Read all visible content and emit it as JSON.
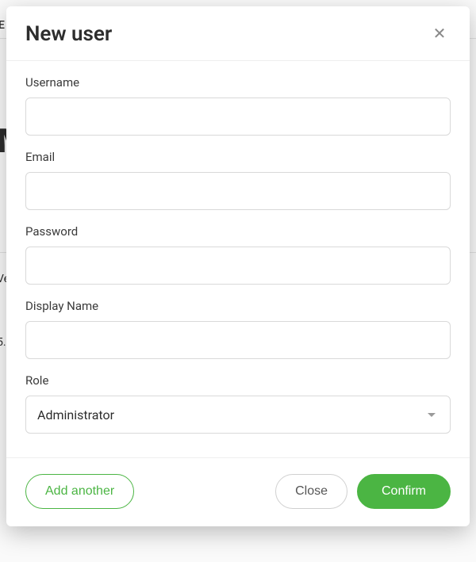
{
  "modal": {
    "title": "New user",
    "fields": {
      "username": {
        "label": "Username",
        "value": ""
      },
      "email": {
        "label": "Email",
        "value": ""
      },
      "password": {
        "label": "Password",
        "value": ""
      },
      "display_name": {
        "label": "Display Name",
        "value": ""
      },
      "role": {
        "label": "Role",
        "selected": "Administrator"
      }
    },
    "footer": {
      "add_another": "Add another",
      "close": "Close",
      "confirm": "Confirm"
    }
  },
  "background_fragments": {
    "e": "E",
    "m": "M",
    "v": "Ve",
    "d": "5."
  },
  "colors": {
    "accent": "#4bb543"
  }
}
